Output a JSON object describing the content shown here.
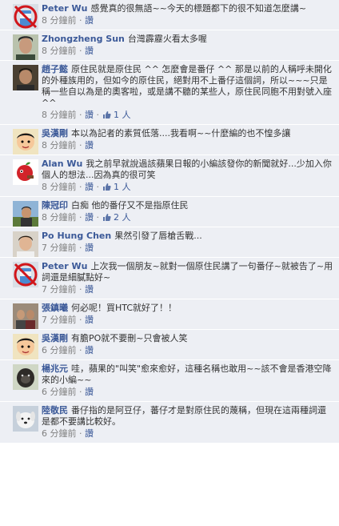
{
  "comments": [
    {
      "id": "c1",
      "avatar": "no-entry-drink",
      "name": "Peter Wu",
      "text": "感覺真的很無語~~今天的標題都下的很不知道怎麼講~",
      "time": "8 分鐘前",
      "like_label": "讚",
      "likes": ""
    },
    {
      "id": "c2",
      "avatar": "man-portrait",
      "name": "Zhongzheng Sun",
      "text": "台灣霹靂火看太多喔",
      "time": "8 分鐘前",
      "like_label": "讚",
      "likes": ""
    },
    {
      "id": "c3",
      "avatar": "man-dark",
      "name": "趙子懿",
      "text": "原住民就是原住民 ^^ 怎麼會是番仔 ^^ 那是以前的人稱呼未開化的外種族用的，但如今的原住民，絕對用不上番仔這個詞，所以~~~只是稱一些自以為是的奧客啦，或是講不聽的某些人，原住民同胞不用對號入座 ^^",
      "time": "8 分鐘前",
      "like_label": "讚",
      "likes": "1 人"
    },
    {
      "id": "c4",
      "avatar": "cartoon-man",
      "name": "吳漢剛",
      "text": "本以為記者的素質低落....我看啊~~什麼編的也不惶多讓",
      "time": "8 分鐘前",
      "like_label": "讚",
      "likes": ""
    },
    {
      "id": "c5",
      "avatar": "apple-character",
      "name": "Alan Wu",
      "text": "我之前早就說過該蘋果日報的小編該發你的新聞就好...少加入你個人的想法...因為真的很可笑",
      "time": "8 分鐘前",
      "like_label": "讚",
      "likes": "1 人"
    },
    {
      "id": "c6",
      "avatar": "man-outdoor",
      "name": "陳冠印",
      "text": "白痴 他的番仔又不是指原住民",
      "time": "8 分鐘前",
      "like_label": "讚",
      "likes": "2 人"
    },
    {
      "id": "c7",
      "avatar": "young-man",
      "name": "Po Hung Chen",
      "text": "果然引發了唇槍舌戰...",
      "time": "7 分鐘前",
      "like_label": "讚",
      "likes": ""
    },
    {
      "id": "c8",
      "avatar": "no-entry-drink",
      "name": "Peter Wu",
      "text": "上次我一個朋友~就對一個原住民講了一句番仔~就被告了~用詞還是細膩點好~",
      "time": "7 分鐘前",
      "like_label": "讚",
      "likes": ""
    },
    {
      "id": "c9",
      "avatar": "man-group",
      "name": "張鎮曦",
      "text": "何必呢！買HTC就好了！！",
      "time": "7 分鐘前",
      "like_label": "讚",
      "likes": ""
    },
    {
      "id": "c10",
      "avatar": "cartoon-man",
      "name": "吳漢剛",
      "text": "有膽PO就不要刪~只會被人笑",
      "time": "6 分鐘前",
      "like_label": "讚",
      "likes": ""
    },
    {
      "id": "c11",
      "avatar": "gorilla",
      "name": "楊兆元",
      "text": "哇，蘋果的\"叫笑\"愈來愈好，這種名稱也敢用~~該不會是香港空降來的小編~~",
      "time": "6 分鐘前",
      "like_label": "讚",
      "likes": ""
    },
    {
      "id": "c12",
      "avatar": "white-dog",
      "name": "陸敬民",
      "text": "番仔指的是阿豆仔，蕃仔才是對原住民的蔑稱，但現在這兩種詞還是都不要講比較好。",
      "time": "6 分鐘前",
      "like_label": "讚",
      "likes": ""
    }
  ]
}
